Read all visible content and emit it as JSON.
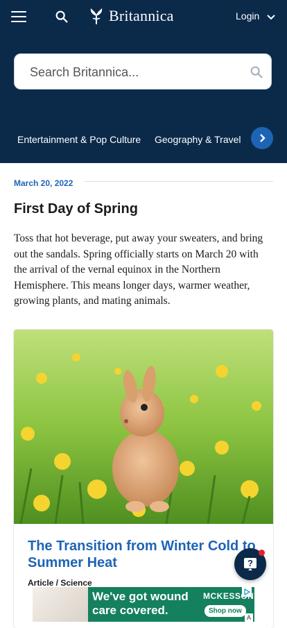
{
  "header": {
    "logo_text": "Britannica",
    "login_label": "Login"
  },
  "search": {
    "placeholder": "Search Britannica..."
  },
  "categories": [
    "Entertainment & Pop Culture",
    "Geography & Travel"
  ],
  "article": {
    "date": "March 20, 2022",
    "title": "First Day of Spring",
    "body": "Toss that hot beverage, put away your sweaters, and bring out the sandals. Spring officially starts on March 20 with the arrival of the vernal equinox in the Northern Hemisphere. This means longer days, warmer weather, growing plants, and mating animals."
  },
  "card": {
    "title": "The Transition from Winter Cold to Summer Heat",
    "meta": "Article / Science"
  },
  "ad": {
    "headline": "We've got wound care covered.",
    "brand": "MCKESSON",
    "cta": "Shop now",
    "badge": "A"
  },
  "colors": {
    "navy": "#0b2a4a",
    "accent_blue": "#1e64b5",
    "notification_red": "#e5202e"
  }
}
